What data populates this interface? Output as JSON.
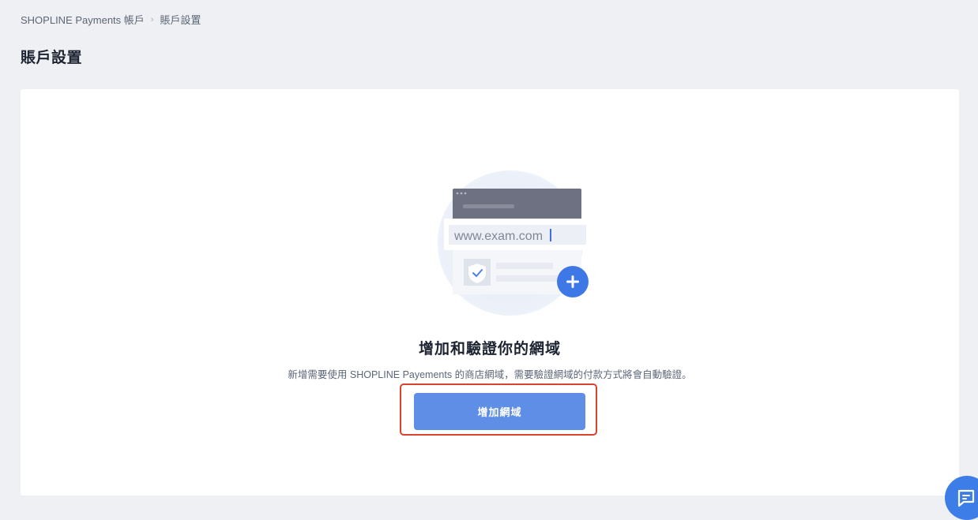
{
  "breadcrumb": {
    "items": [
      "SHOPLINE Payments 帳戶",
      "賬戶設置"
    ],
    "separator": "›"
  },
  "page": {
    "title": "賬戶設置"
  },
  "empty_state": {
    "illustration": {
      "url_text": "www.exam.com",
      "icons": [
        "browser-window-icon",
        "shield-check-icon",
        "plus-icon"
      ]
    },
    "title": "增加和驗證你的網域",
    "description": "新增需要使用 SHOPLINE Payements 的商店網域，需要驗證網域的付款方式將會自動驗證。",
    "button_label": "增加網域"
  },
  "chat": {
    "icon": "chat-icon"
  },
  "colors": {
    "page_background": "#eef0f3",
    "card_background": "#ffffff",
    "primary_button": "#5f8ee6",
    "highlight_border": "#d9432e",
    "chat_button": "#3d7de8"
  }
}
